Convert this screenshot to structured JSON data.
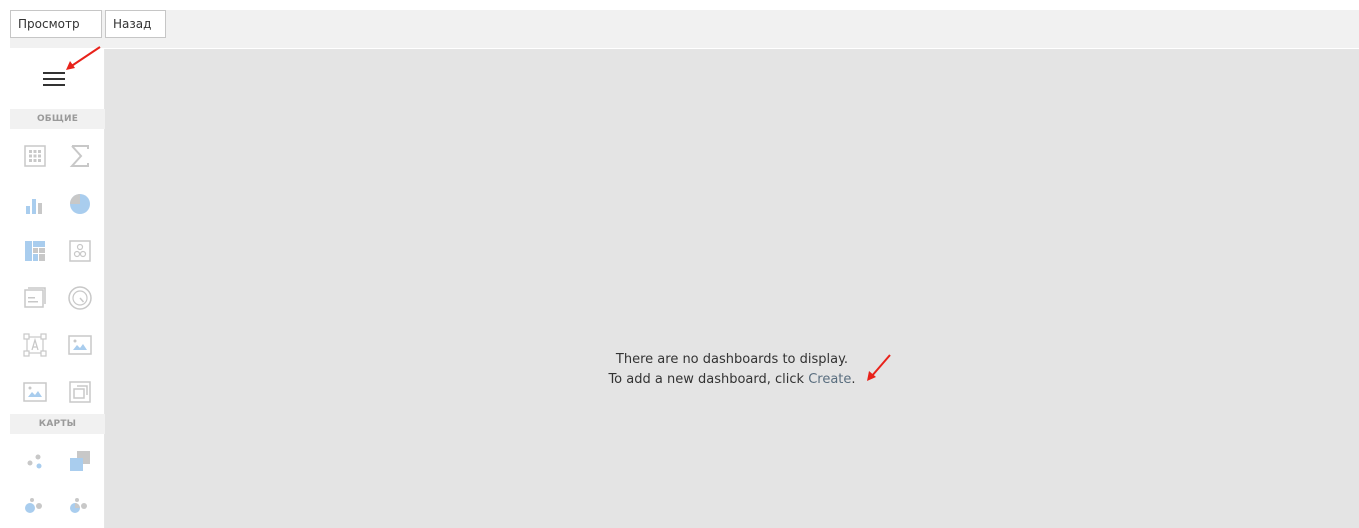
{
  "toolbar": {
    "view_tab": "Просмотр",
    "back_tab": "Назад"
  },
  "sidebar": {
    "groups": [
      {
        "label": "ОБЩИЕ"
      },
      {
        "label": "КАРТЫ"
      }
    ],
    "general_items": [
      "grid-icon",
      "sum-icon",
      "bar-chart-icon",
      "pie-chart-icon",
      "treemap-icon",
      "scatter-icon",
      "card-icon",
      "gauge-icon",
      "text-box-icon",
      "image-icon",
      "bound-image-icon",
      "group-icon"
    ],
    "map_items": [
      "geo-point-map-icon",
      "choropleth-map-icon",
      "bubble-map-icon",
      "pie-map-icon"
    ]
  },
  "main": {
    "empty_line1": "There are no dashboards to display.",
    "empty_line2_prefix": "To add a new dashboard, click ",
    "create_link": "Create",
    "empty_line2_suffix": "."
  },
  "colors": {
    "toolbar_bg": "#f1f1f1",
    "canvas_bg": "#e4e4e4",
    "icon_blue": "#a9cdee",
    "icon_gray": "#c8c8c8",
    "annotation_arrow": "#e8221a",
    "link": "#5a6e7f"
  }
}
